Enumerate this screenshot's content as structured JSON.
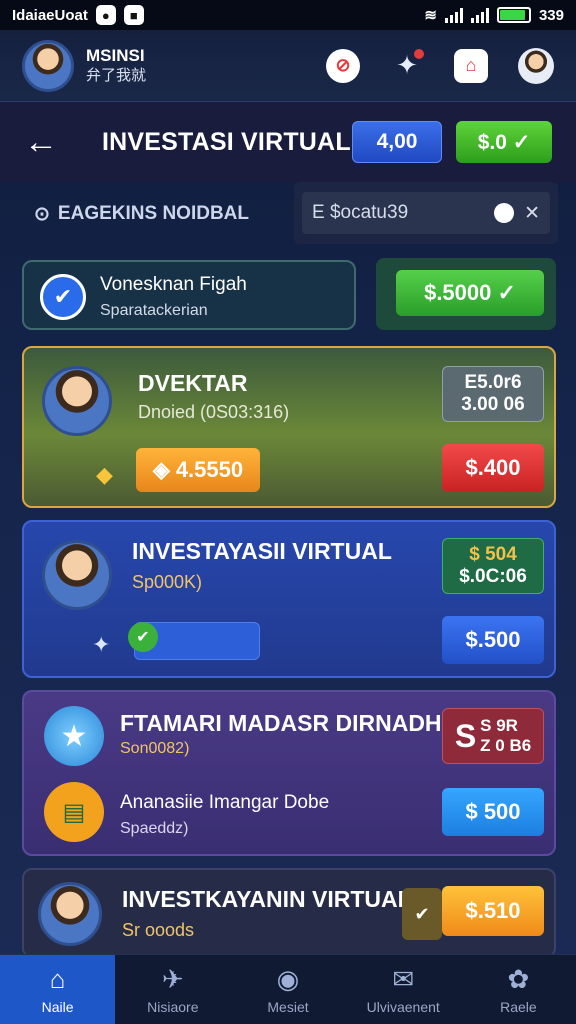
{
  "status": {
    "carrier": "IdaiaeUoat",
    "time": "339",
    "battery_level": 0.9
  },
  "header": {
    "user_name": "MSINSI",
    "user_sub": "弁了我就",
    "icons": [
      "alert-icon",
      "star-icon",
      "home-icon",
      "profile-icon"
    ]
  },
  "titlebar": {
    "back_icon": "arrow-left-icon",
    "title": "INVESTASI VIRTUAL",
    "balance_a": "4,00",
    "balance_b": "$.0 ✓"
  },
  "search": {
    "label": "EAGEKINS NOIDBAL",
    "value": "E $ocatu39",
    "icon": "search-icon"
  },
  "promo": {
    "title": "Vonesknan Figah",
    "subtitle": "Sparatackerian",
    "cta": "$.5000 ✓"
  },
  "cards": [
    {
      "title": "DVEKTAR",
      "subtitle": "Dnoied (0S03:316)",
      "badge_line1": "E5.0r6",
      "badge_line2": "3.00 06",
      "action_left": "4.5550",
      "action_right": "$.400"
    },
    {
      "title": "INVESTAYASII VIRTUAL",
      "subtitle": "Sp000K)",
      "badge_line1": "$ 504",
      "badge_line2": "$.0C:06",
      "action_left": "",
      "action_right": "$.500"
    },
    {
      "title": "FTAMARI MADASR DIRNADHA",
      "subtitle": "Son0082)",
      "badge_line1": "S 9R",
      "badge_line2": "Z 0 B6",
      "row2_title": "Ananasiie Imangar Dobe",
      "row2_sub": "Spaeddz)",
      "action_right": "$ 500"
    },
    {
      "title": "INVESTKAYANIN VIRTUAL",
      "subtitle": "Sr ooods",
      "action_right": "$.510"
    }
  ],
  "tabs": [
    {
      "label": "Naile",
      "icon": "home-icon",
      "active": true
    },
    {
      "label": "Nisiaore",
      "icon": "plane-icon",
      "active": false
    },
    {
      "label": "Mesiet",
      "icon": "chat-icon",
      "active": false
    },
    {
      "label": "Ulvivaenent",
      "icon": "mail-icon",
      "active": false
    },
    {
      "label": "Raele",
      "icon": "grid-icon",
      "active": false
    }
  ],
  "colors": {
    "accent": "#1e57c8",
    "green": "#3bb03a",
    "red": "#e53a3a",
    "gold": "#f2a21c"
  }
}
